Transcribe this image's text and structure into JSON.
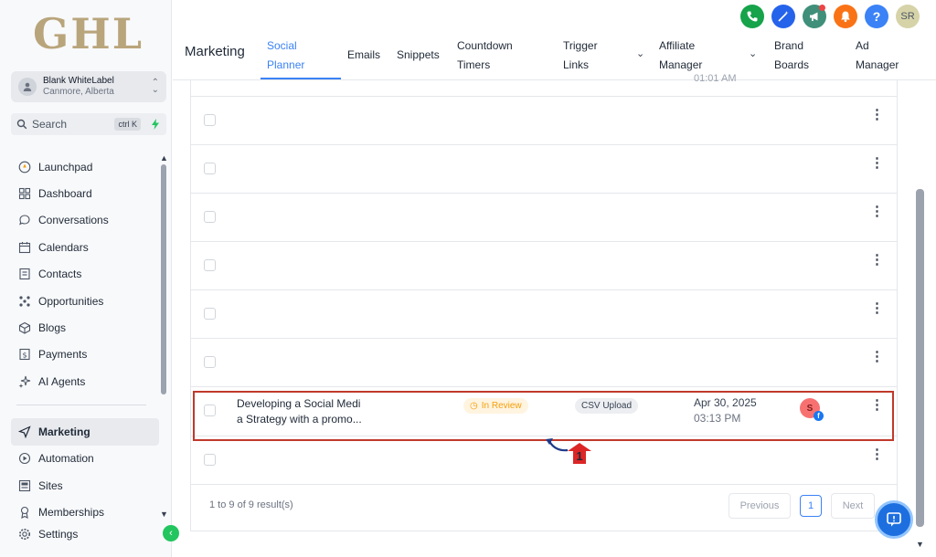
{
  "logo": "GHL",
  "account": {
    "name": "Blank WhiteLabel",
    "location": "Canmore, Alberta"
  },
  "search": {
    "label": "Search",
    "shortcut": "ctrl K"
  },
  "sidebar": {
    "items": [
      {
        "label": "Launchpad",
        "icon": "rocket-icon"
      },
      {
        "label": "Dashboard",
        "icon": "dashboard-icon"
      },
      {
        "label": "Conversations",
        "icon": "chat-icon"
      },
      {
        "label": "Calendars",
        "icon": "calendar-icon"
      },
      {
        "label": "Contacts",
        "icon": "contacts-icon"
      },
      {
        "label": "Opportunities",
        "icon": "opportunities-icon"
      },
      {
        "label": "Blogs",
        "icon": "blog-icon"
      },
      {
        "label": "Payments",
        "icon": "payments-icon"
      },
      {
        "label": "AI Agents",
        "icon": "sparkle-icon"
      }
    ],
    "items2": [
      {
        "label": "Marketing",
        "icon": "send-icon",
        "active": true
      },
      {
        "label": "Automation",
        "icon": "automation-icon"
      },
      {
        "label": "Sites",
        "icon": "sites-icon"
      },
      {
        "label": "Memberships",
        "icon": "membership-icon"
      },
      {
        "label": "Settings",
        "icon": "gear-icon"
      }
    ]
  },
  "header": {
    "title": "Marketing",
    "tabs": [
      {
        "line1": "Social",
        "line2": "Planner",
        "active": true
      },
      {
        "line1": "Emails"
      },
      {
        "line1": "Snippets"
      },
      {
        "line1": "Countdown",
        "line2": "Timers"
      },
      {
        "line1": "Trigger",
        "line2": "Links",
        "dropdown": true
      },
      {
        "line1": "Affiliate",
        "line2": "Manager",
        "dropdown": true
      },
      {
        "line1": "Brand",
        "line2": "Boards"
      },
      {
        "line1": "Ad",
        "line2": "Manager"
      }
    ],
    "user_initials": "SR",
    "help_label": "?",
    "colors": {
      "phone": "#16a34a",
      "magic": "#2563eb",
      "megaphone": "#3f8f7a",
      "bell": "#f97316",
      "help": "#3b82f6"
    }
  },
  "table": {
    "first_row_time": "01:01 AM",
    "highlight_row": {
      "post_text_line1": "Developing a Social Medi",
      "post_text_line2": "a Strategy with a promo...",
      "status": "In Review",
      "source": "CSV Upload",
      "date": "Apr 30, 2025",
      "time": "03:13 PM",
      "avatar_initial": "S",
      "network_badge": "f"
    },
    "pagination": {
      "info": "1 to 9 of 9 result(s)",
      "previous": "Previous",
      "current_page": "1",
      "next": "Next"
    }
  },
  "marker": {
    "number": "1"
  }
}
